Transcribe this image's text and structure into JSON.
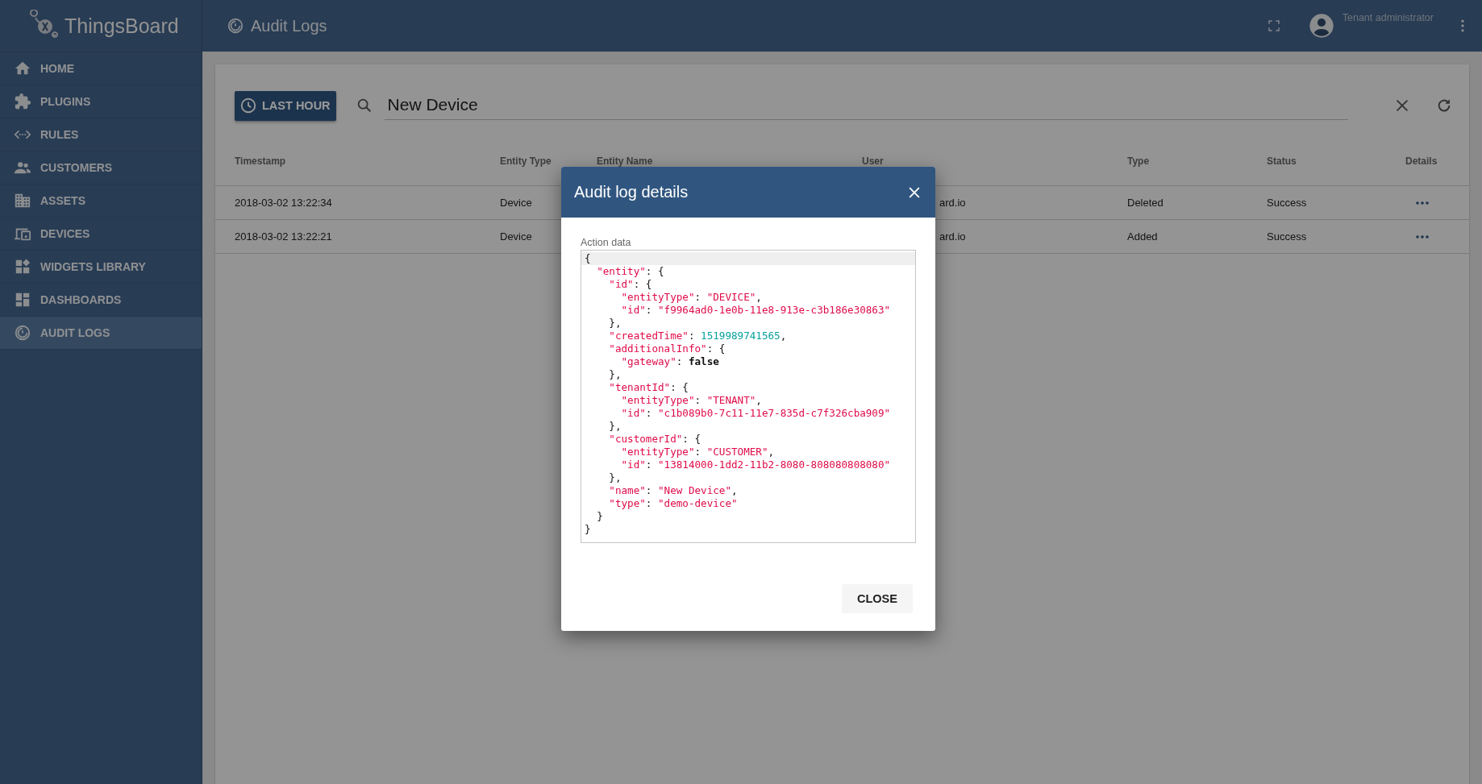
{
  "app": {
    "logo": "ThingsBoard"
  },
  "sidebar": {
    "items": [
      {
        "label": "HOME",
        "kind": "home",
        "selected": false
      },
      {
        "label": "PLUGINS",
        "kind": "puzzle",
        "selected": false
      },
      {
        "label": "RULES",
        "kind": "code",
        "selected": false
      },
      {
        "label": "CUSTOMERS",
        "kind": "people",
        "selected": false
      },
      {
        "label": "ASSETS",
        "kind": "building",
        "selected": false
      },
      {
        "label": "DEVICES",
        "kind": "devices",
        "selected": false
      },
      {
        "label": "WIDGETS LIBRARY",
        "kind": "widgets",
        "selected": false
      },
      {
        "label": "DASHBOARDS",
        "kind": "dashboard",
        "selected": false
      },
      {
        "label": "AUDIT LOGS",
        "kind": "audit",
        "selected": true
      }
    ]
  },
  "header": {
    "title": "Audit Logs",
    "user": "Tenant administrator"
  },
  "toolbar": {
    "time_button": "LAST HOUR",
    "search": {
      "value": "New Device"
    }
  },
  "table": {
    "columns": [
      "Timestamp",
      "Entity Type",
      "Entity Name",
      "User",
      "Type",
      "Status",
      "Details"
    ],
    "rows": [
      {
        "timestamp": "2018-03-02 13:22:34",
        "entity_type": "Device",
        "user": "ard.io",
        "type": "Deleted",
        "status": "Success"
      },
      {
        "timestamp": "2018-03-02 13:22:21",
        "entity_type": "Device",
        "user": "ard.io",
        "type": "Added",
        "status": "Success"
      }
    ]
  },
  "dialog": {
    "title": "Audit log details",
    "field_label": "Action data",
    "close_button": "CLOSE",
    "code_lines": [
      {
        "active": true,
        "tokens": [
          {
            "t": "{",
            "kind": "punct"
          }
        ]
      },
      {
        "active": false,
        "tokens": [
          {
            "t": "  \"entity\"",
            "kind": "key"
          },
          {
            "t": ": {",
            "kind": "punct"
          }
        ]
      },
      {
        "active": false,
        "tokens": [
          {
            "t": "    \"id\"",
            "kind": "key"
          },
          {
            "t": ": {",
            "kind": "punct"
          }
        ]
      },
      {
        "active": false,
        "tokens": [
          {
            "t": "      \"entityType\"",
            "kind": "key"
          },
          {
            "t": ": ",
            "kind": "punct"
          },
          {
            "t": "\"DEVICE\"",
            "kind": "string"
          },
          {
            "t": ",",
            "kind": "punct"
          }
        ]
      },
      {
        "active": false,
        "tokens": [
          {
            "t": "      \"id\"",
            "kind": "key"
          },
          {
            "t": ": ",
            "kind": "punct"
          },
          {
            "t": "\"f9964ad0-1e0b-11e8-913e-c3b186e30863\"",
            "kind": "string"
          }
        ]
      },
      {
        "active": false,
        "tokens": [
          {
            "t": "    },",
            "kind": "punct"
          }
        ]
      },
      {
        "active": false,
        "tokens": [
          {
            "t": "    \"createdTime\"",
            "kind": "key"
          },
          {
            "t": ": ",
            "kind": "punct"
          },
          {
            "t": "1519989741565",
            "kind": "number"
          },
          {
            "t": ",",
            "kind": "punct"
          }
        ]
      },
      {
        "active": false,
        "tokens": [
          {
            "t": "    \"additionalInfo\"",
            "kind": "key"
          },
          {
            "t": ": {",
            "kind": "punct"
          }
        ]
      },
      {
        "active": false,
        "tokens": [
          {
            "t": "      \"gateway\"",
            "kind": "key"
          },
          {
            "t": ": ",
            "kind": "punct"
          },
          {
            "t": "false",
            "kind": "bool"
          }
        ]
      },
      {
        "active": false,
        "tokens": [
          {
            "t": "    },",
            "kind": "punct"
          }
        ]
      },
      {
        "active": false,
        "tokens": [
          {
            "t": "    \"tenantId\"",
            "kind": "key"
          },
          {
            "t": ": {",
            "kind": "punct"
          }
        ]
      },
      {
        "active": false,
        "tokens": [
          {
            "t": "      \"entityType\"",
            "kind": "key"
          },
          {
            "t": ": ",
            "kind": "punct"
          },
          {
            "t": "\"TENANT\"",
            "kind": "string"
          },
          {
            "t": ",",
            "kind": "punct"
          }
        ]
      },
      {
        "active": false,
        "tokens": [
          {
            "t": "      \"id\"",
            "kind": "key"
          },
          {
            "t": ": ",
            "kind": "punct"
          },
          {
            "t": "\"c1b089b0-7c11-11e7-835d-c7f326cba909\"",
            "kind": "string"
          }
        ]
      },
      {
        "active": false,
        "tokens": [
          {
            "t": "    },",
            "kind": "punct"
          }
        ]
      },
      {
        "active": false,
        "tokens": [
          {
            "t": "    \"customerId\"",
            "kind": "key"
          },
          {
            "t": ": {",
            "kind": "punct"
          }
        ]
      },
      {
        "active": false,
        "tokens": [
          {
            "t": "      \"entityType\"",
            "kind": "key"
          },
          {
            "t": ": ",
            "kind": "punct"
          },
          {
            "t": "\"CUSTOMER\"",
            "kind": "string"
          },
          {
            "t": ",",
            "kind": "punct"
          }
        ]
      },
      {
        "active": false,
        "tokens": [
          {
            "t": "      \"id\"",
            "kind": "key"
          },
          {
            "t": ": ",
            "kind": "punct"
          },
          {
            "t": "\"13814000-1dd2-11b2-8080-808080808080\"",
            "kind": "string"
          }
        ]
      },
      {
        "active": false,
        "tokens": [
          {
            "t": "    },",
            "kind": "punct"
          }
        ]
      },
      {
        "active": false,
        "tokens": [
          {
            "t": "    \"name\"",
            "kind": "key"
          },
          {
            "t": ": ",
            "kind": "punct"
          },
          {
            "t": "\"New Device\"",
            "kind": "string"
          },
          {
            "t": ",",
            "kind": "punct"
          }
        ]
      },
      {
        "active": false,
        "tokens": [
          {
            "t": "    \"type\"",
            "kind": "key"
          },
          {
            "t": ": ",
            "kind": "punct"
          },
          {
            "t": "\"demo-device\"",
            "kind": "string"
          }
        ]
      },
      {
        "active": false,
        "tokens": [
          {
            "t": "  }",
            "kind": "punct"
          }
        ]
      },
      {
        "active": false,
        "tokens": [
          {
            "t": "}",
            "kind": "punct"
          }
        ]
      }
    ]
  }
}
